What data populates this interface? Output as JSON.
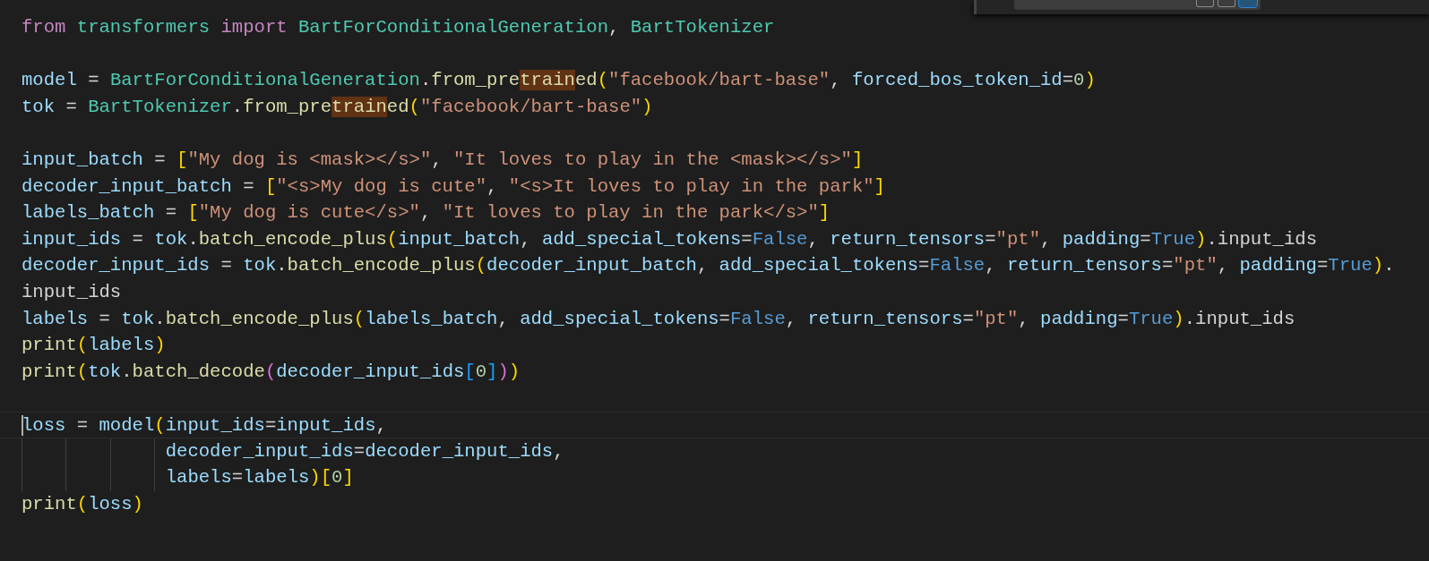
{
  "find_widget": {
    "option_toggles": [
      {
        "selected": false
      },
      {
        "selected": false
      },
      {
        "selected": true
      }
    ]
  },
  "editor": {
    "lines": [
      {
        "kind": "code",
        "tokens": [
          {
            "text": "from",
            "kind": "keyword"
          },
          {
            "text": " transformers",
            "kind": "class"
          },
          {
            "text": " import",
            "kind": "keyword"
          },
          {
            "text": " BartForConditionalGeneration",
            "kind": "class"
          },
          {
            "text": ", ",
            "kind": "plain"
          },
          {
            "text": "BartTokenizer",
            "kind": "class"
          }
        ]
      },
      {
        "kind": "blank"
      },
      {
        "kind": "code",
        "tokens": [
          {
            "text": "model",
            "kind": "var"
          },
          {
            "text": " = ",
            "kind": "plain"
          },
          {
            "text": "BartForConditionalGeneration",
            "kind": "class"
          },
          {
            "text": ".",
            "kind": "plain"
          },
          {
            "text": "from_pre",
            "kind": "func"
          },
          {
            "text": "train",
            "kind": "func",
            "match": true
          },
          {
            "text": "ed",
            "kind": "func"
          },
          {
            "text": "(",
            "kind": "bracket1"
          },
          {
            "text": "\"facebook/bart-base\"",
            "kind": "string"
          },
          {
            "text": ", ",
            "kind": "plain"
          },
          {
            "text": "forced_bos_token_id",
            "kind": "var"
          },
          {
            "text": "=",
            "kind": "plain"
          },
          {
            "text": "0",
            "kind": "number"
          },
          {
            "text": ")",
            "kind": "bracket1"
          }
        ]
      },
      {
        "kind": "code",
        "tokens": [
          {
            "text": "tok",
            "kind": "var"
          },
          {
            "text": " = ",
            "kind": "plain"
          },
          {
            "text": "BartTokenizer",
            "kind": "class"
          },
          {
            "text": ".",
            "kind": "plain"
          },
          {
            "text": "from_pre",
            "kind": "func"
          },
          {
            "text": "train",
            "kind": "func",
            "match": true
          },
          {
            "text": "ed",
            "kind": "func"
          },
          {
            "text": "(",
            "kind": "bracket1"
          },
          {
            "text": "\"facebook/bart-base\"",
            "kind": "string"
          },
          {
            "text": ")",
            "kind": "bracket1"
          }
        ]
      },
      {
        "kind": "blank"
      },
      {
        "kind": "code",
        "tokens": [
          {
            "text": "input_batch",
            "kind": "var"
          },
          {
            "text": " = ",
            "kind": "plain"
          },
          {
            "text": "[",
            "kind": "bracket1"
          },
          {
            "text": "\"My dog is <mask></s>\"",
            "kind": "string"
          },
          {
            "text": ", ",
            "kind": "plain"
          },
          {
            "text": "\"It loves to play in the <mask></s>\"",
            "kind": "string"
          },
          {
            "text": "]",
            "kind": "bracket1"
          }
        ]
      },
      {
        "kind": "code",
        "tokens": [
          {
            "text": "decoder_input_batch",
            "kind": "var"
          },
          {
            "text": " = ",
            "kind": "plain"
          },
          {
            "text": "[",
            "kind": "bracket1"
          },
          {
            "text": "\"<s>My dog is cute\"",
            "kind": "string"
          },
          {
            "text": ", ",
            "kind": "plain"
          },
          {
            "text": "\"<s>It loves to play in the park\"",
            "kind": "string"
          },
          {
            "text": "]",
            "kind": "bracket1"
          }
        ]
      },
      {
        "kind": "code",
        "tokens": [
          {
            "text": "labels_batch",
            "kind": "var"
          },
          {
            "text": " = ",
            "kind": "plain"
          },
          {
            "text": "[",
            "kind": "bracket1"
          },
          {
            "text": "\"My dog is cute</s>\"",
            "kind": "string"
          },
          {
            "text": ", ",
            "kind": "plain"
          },
          {
            "text": "\"It loves to play in the park</s>\"",
            "kind": "string"
          },
          {
            "text": "]",
            "kind": "bracket1"
          }
        ]
      },
      {
        "kind": "code",
        "tokens": [
          {
            "text": "input_ids",
            "kind": "var"
          },
          {
            "text": " = ",
            "kind": "plain"
          },
          {
            "text": "tok",
            "kind": "var"
          },
          {
            "text": ".",
            "kind": "plain"
          },
          {
            "text": "batch_encode_plus",
            "kind": "func"
          },
          {
            "text": "(",
            "kind": "bracket1"
          },
          {
            "text": "input_batch",
            "kind": "var"
          },
          {
            "text": ", ",
            "kind": "plain"
          },
          {
            "text": "add_special_tokens",
            "kind": "var"
          },
          {
            "text": "=",
            "kind": "plain"
          },
          {
            "text": "False",
            "kind": "const"
          },
          {
            "text": ", ",
            "kind": "plain"
          },
          {
            "text": "return_tensors",
            "kind": "var"
          },
          {
            "text": "=",
            "kind": "plain"
          },
          {
            "text": "\"pt\"",
            "kind": "string"
          },
          {
            "text": ", ",
            "kind": "plain"
          },
          {
            "text": "padding",
            "kind": "var"
          },
          {
            "text": "=",
            "kind": "plain"
          },
          {
            "text": "True",
            "kind": "const"
          },
          {
            "text": ")",
            "kind": "bracket1"
          },
          {
            "text": ".input_ids",
            "kind": "plain"
          }
        ]
      },
      {
        "kind": "code",
        "tokens": [
          {
            "text": "decoder_input_ids",
            "kind": "var"
          },
          {
            "text": " = ",
            "kind": "plain"
          },
          {
            "text": "tok",
            "kind": "var"
          },
          {
            "text": ".",
            "kind": "plain"
          },
          {
            "text": "batch_encode_plus",
            "kind": "func"
          },
          {
            "text": "(",
            "kind": "bracket1"
          },
          {
            "text": "decoder_input_batch",
            "kind": "var"
          },
          {
            "text": ", ",
            "kind": "plain"
          },
          {
            "text": "add_special_tokens",
            "kind": "var"
          },
          {
            "text": "=",
            "kind": "plain"
          },
          {
            "text": "False",
            "kind": "const"
          },
          {
            "text": ", ",
            "kind": "plain"
          },
          {
            "text": "return_tensors",
            "kind": "var"
          },
          {
            "text": "=",
            "kind": "plain"
          },
          {
            "text": "\"pt\"",
            "kind": "string"
          },
          {
            "text": ", ",
            "kind": "plain"
          },
          {
            "text": "padding",
            "kind": "var"
          },
          {
            "text": "=",
            "kind": "plain"
          },
          {
            "text": "True",
            "kind": "const"
          },
          {
            "text": ")",
            "kind": "bracket1"
          },
          {
            "text": ".",
            "kind": "plain"
          }
        ]
      },
      {
        "kind": "code",
        "tokens": [
          {
            "text": "input_ids",
            "kind": "plain"
          }
        ]
      },
      {
        "kind": "code",
        "tokens": [
          {
            "text": "labels",
            "kind": "var"
          },
          {
            "text": " = ",
            "kind": "plain"
          },
          {
            "text": "tok",
            "kind": "var"
          },
          {
            "text": ".",
            "kind": "plain"
          },
          {
            "text": "batch_encode_plus",
            "kind": "func"
          },
          {
            "text": "(",
            "kind": "bracket1"
          },
          {
            "text": "labels_batch",
            "kind": "var"
          },
          {
            "text": ", ",
            "kind": "plain"
          },
          {
            "text": "add_special_tokens",
            "kind": "var"
          },
          {
            "text": "=",
            "kind": "plain"
          },
          {
            "text": "False",
            "kind": "const"
          },
          {
            "text": ", ",
            "kind": "plain"
          },
          {
            "text": "return_tensors",
            "kind": "var"
          },
          {
            "text": "=",
            "kind": "plain"
          },
          {
            "text": "\"pt\"",
            "kind": "string"
          },
          {
            "text": ", ",
            "kind": "plain"
          },
          {
            "text": "padding",
            "kind": "var"
          },
          {
            "text": "=",
            "kind": "plain"
          },
          {
            "text": "True",
            "kind": "const"
          },
          {
            "text": ")",
            "kind": "bracket1"
          },
          {
            "text": ".input_ids",
            "kind": "plain"
          }
        ]
      },
      {
        "kind": "code",
        "tokens": [
          {
            "text": "print",
            "kind": "func"
          },
          {
            "text": "(",
            "kind": "bracket1"
          },
          {
            "text": "labels",
            "kind": "var"
          },
          {
            "text": ")",
            "kind": "bracket1"
          }
        ]
      },
      {
        "kind": "code",
        "tokens": [
          {
            "text": "print",
            "kind": "func"
          },
          {
            "text": "(",
            "kind": "bracket1"
          },
          {
            "text": "tok",
            "kind": "var"
          },
          {
            "text": ".",
            "kind": "plain"
          },
          {
            "text": "batch_decode",
            "kind": "func"
          },
          {
            "text": "(",
            "kind": "bracket2"
          },
          {
            "text": "decoder_input_ids",
            "kind": "var"
          },
          {
            "text": "[",
            "kind": "bracket3"
          },
          {
            "text": "0",
            "kind": "number"
          },
          {
            "text": "]",
            "kind": "bracket3"
          },
          {
            "text": ")",
            "kind": "bracket2"
          },
          {
            "text": ")",
            "kind": "bracket1"
          }
        ]
      },
      {
        "kind": "blank"
      },
      {
        "kind": "code",
        "current": true,
        "tokens": [
          {
            "text": "loss",
            "kind": "var"
          },
          {
            "text": " = ",
            "kind": "plain"
          },
          {
            "text": "model",
            "kind": "var"
          },
          {
            "text": "(",
            "kind": "bracket1"
          },
          {
            "text": "input_ids",
            "kind": "var"
          },
          {
            "text": "=",
            "kind": "plain"
          },
          {
            "text": "input_ids",
            "kind": "var"
          },
          {
            "text": ",",
            "kind": "plain"
          }
        ]
      },
      {
        "kind": "continuation",
        "tokens": [
          {
            "text": "decoder_input_ids",
            "kind": "var"
          },
          {
            "text": "=",
            "kind": "plain"
          },
          {
            "text": "decoder_input_ids",
            "kind": "var"
          },
          {
            "text": ",",
            "kind": "plain"
          }
        ]
      },
      {
        "kind": "continuation",
        "tokens": [
          {
            "text": "labels",
            "kind": "var"
          },
          {
            "text": "=",
            "kind": "plain"
          },
          {
            "text": "labels",
            "kind": "var"
          },
          {
            "text": ")",
            "kind": "bracket1"
          },
          {
            "text": "[",
            "kind": "bracket1"
          },
          {
            "text": "0",
            "kind": "number"
          },
          {
            "text": "]",
            "kind": "bracket1"
          }
        ]
      },
      {
        "kind": "code",
        "tokens": [
          {
            "text": "print",
            "kind": "func"
          },
          {
            "text": "(",
            "kind": "bracket1"
          },
          {
            "text": "loss",
            "kind": "var"
          },
          {
            "text": ")",
            "kind": "bracket1"
          }
        ]
      }
    ]
  }
}
